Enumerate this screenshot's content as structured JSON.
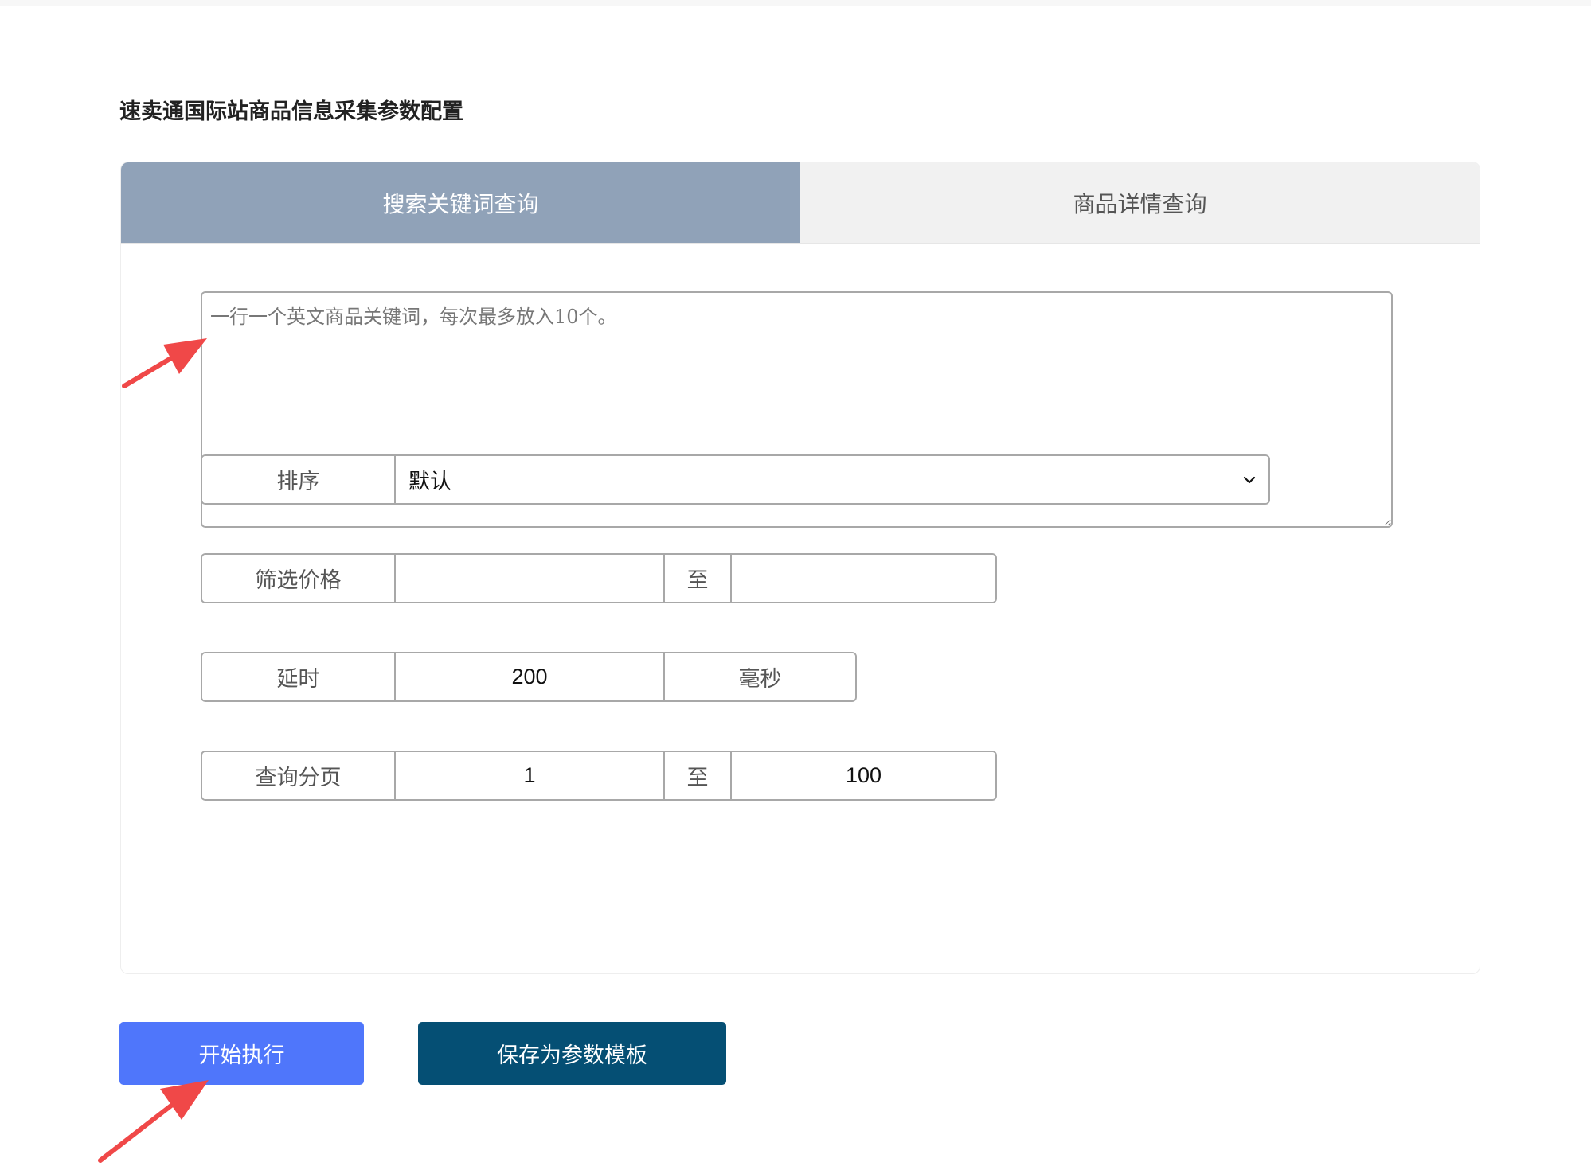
{
  "page": {
    "title": "速卖通国际站商品信息采集参数配置"
  },
  "tabs": [
    {
      "label": "搜索关键词查询",
      "active": true
    },
    {
      "label": "商品详情查询",
      "active": false
    }
  ],
  "keywords": {
    "placeholder": "一行一个英文商品关键词，每次最多放入10个。",
    "value": ""
  },
  "sort": {
    "label": "排序",
    "selected": "默认"
  },
  "price_filter": {
    "label": "筛选价格",
    "min": "",
    "separator": "至",
    "max": ""
  },
  "delay": {
    "label": "延时",
    "value": "200",
    "unit": "毫秒"
  },
  "pagination": {
    "label": "查询分页",
    "from": "1",
    "separator": "至",
    "to": "100"
  },
  "actions": {
    "start_label": "开始执行",
    "save_label": "保存为参数模板"
  },
  "colors": {
    "active_tab": "#90a2b8",
    "inactive_tab": "#f1f1f1",
    "start_button": "#4f76fb",
    "save_button": "#054f74",
    "annotation_arrow": "#f04848"
  },
  "icons": {
    "select": "chevron-down-icon",
    "annotation": "arrow-icon"
  }
}
